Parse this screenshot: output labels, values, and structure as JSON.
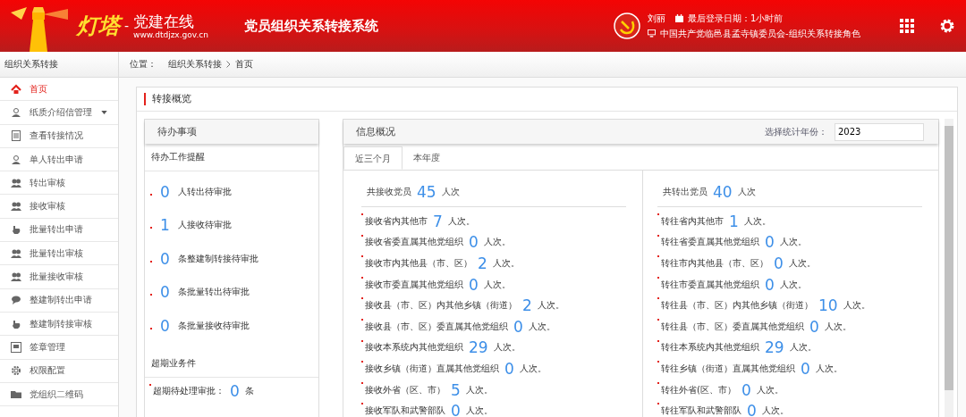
{
  "header": {
    "logo_text": "灯塔",
    "logo_dash": "-",
    "logo_sub": "党建在线",
    "logo_url": "www.dtdjzx.gov.cn",
    "system_title": "党员组织关系转接系统",
    "user_name": "刘丽",
    "last_login": "最后登录日期：1小时前",
    "org": "中国共产党临邑县孟寺镇委员会-组织关系转接角色"
  },
  "sidebar": {
    "title": "组织关系转接",
    "items": [
      {
        "label": "首页",
        "kind": "home",
        "selected": true,
        "expandable": false
      },
      {
        "label": "纸质介绍信管理",
        "kind": "person",
        "selected": false,
        "expandable": true
      },
      {
        "label": "查看转接情况",
        "kind": "document",
        "selected": false,
        "expandable": false
      },
      {
        "label": "单人转出申请",
        "kind": "person",
        "selected": false,
        "expandable": false
      },
      {
        "label": "转出审核",
        "kind": "people",
        "selected": false,
        "expandable": false
      },
      {
        "label": "接收审核",
        "kind": "people",
        "selected": false,
        "expandable": false
      },
      {
        "label": "批量转出申请",
        "kind": "hand",
        "selected": false,
        "expandable": false
      },
      {
        "label": "批量转出审核",
        "kind": "people",
        "selected": false,
        "expandable": false
      },
      {
        "label": "批量接收审核",
        "kind": "people",
        "selected": false,
        "expandable": false
      },
      {
        "label": "整建制转出申请",
        "kind": "chat",
        "selected": false,
        "expandable": false
      },
      {
        "label": "整建制转接审核",
        "kind": "hand",
        "selected": false,
        "expandable": false
      },
      {
        "label": "签章管理",
        "kind": "stamp",
        "selected": false,
        "expandable": false
      },
      {
        "label": "权限配置",
        "kind": "gear",
        "selected": false,
        "expandable": false
      },
      {
        "label": "党组织二维码",
        "kind": "folder",
        "selected": false,
        "expandable": false
      }
    ]
  },
  "breadcrumb": {
    "label": "位置：",
    "items": [
      "组织关系转接",
      "首页"
    ]
  },
  "overview": {
    "title": "转接概览"
  },
  "todo": {
    "title": "待办事项",
    "reminder_heading": "待办工作提醒",
    "reminders": [
      {
        "count": "0",
        "label": "人转出待审批"
      },
      {
        "count": "1",
        "label": "人接收待审批"
      },
      {
        "count": "0",
        "label": "条整建制转接待审批"
      },
      {
        "count": "0",
        "label": "条批量转出待审批"
      },
      {
        "count": "0",
        "label": "条批量接收待审批"
      }
    ],
    "overdue_heading": "超期业务件",
    "overdue": [
      {
        "label": "超期待处理审批：",
        "count": "0",
        "unit": "条"
      }
    ]
  },
  "info": {
    "title": "信息概况",
    "year_label": "选择统计年份：",
    "year_value": "2023",
    "tabs": [
      {
        "label": "近三个月",
        "selected": true
      },
      {
        "label": "本年度",
        "selected": false
      }
    ],
    "columns": [
      {
        "heading": "共接收党员",
        "total": "45",
        "unit": "人次",
        "rows": [
          {
            "label": "接收省内其他市",
            "count": "7",
            "unit": "人次。"
          },
          {
            "label": "接收省委直属其他党组织",
            "count": "0",
            "unit": "人次。"
          },
          {
            "label": "接收市内其他县（市、区）",
            "count": "2",
            "unit": "人次。"
          },
          {
            "label": "接收市委直属其他党组织",
            "count": "0",
            "unit": "人次。"
          },
          {
            "label": "接收县（市、区）内其他乡镇（街道）",
            "count": "2",
            "unit": "人次。"
          },
          {
            "label": "接收县（市、区）委直属其他党组织",
            "count": "0",
            "unit": "人次。"
          },
          {
            "label": "接收本系统内其他党组织",
            "count": "29",
            "unit": "人次。"
          },
          {
            "label": "接收乡镇（街道）直属其他党组织",
            "count": "0",
            "unit": "人次。"
          },
          {
            "label": "接收外省（区、市）",
            "count": "5",
            "unit": "人次。"
          },
          {
            "label": "接收军队和武警部队",
            "count": "0",
            "unit": "人次。"
          }
        ]
      },
      {
        "heading": "共转出党员",
        "total": "40",
        "unit": "人次",
        "rows": [
          {
            "label": "转往省内其他市",
            "count": "1",
            "unit": "人次。"
          },
          {
            "label": "转往省委直属其他党组织",
            "count": "0",
            "unit": "人次。"
          },
          {
            "label": "转往市内其他县（市、区）",
            "count": "0",
            "unit": "人次。"
          },
          {
            "label": "转往市委直属其他党组织",
            "count": "0",
            "unit": "人次。"
          },
          {
            "label": "转往县（市、区）内其他乡镇（街道）",
            "count": "10",
            "unit": "人次。"
          },
          {
            "label": "转往县（市、区）委直属其他党组织",
            "count": "0",
            "unit": "人次。"
          },
          {
            "label": "转往本系统内其他党组织",
            "count": "29",
            "unit": "人次。"
          },
          {
            "label": "转往乡镇（街道）直属其他党组织",
            "count": "0",
            "unit": "人次。"
          },
          {
            "label": "转往外省(区、市）",
            "count": "0",
            "unit": "人次。"
          },
          {
            "label": "转往军队和武警部队",
            "count": "0",
            "unit": "人次。"
          }
        ]
      }
    ]
  }
}
